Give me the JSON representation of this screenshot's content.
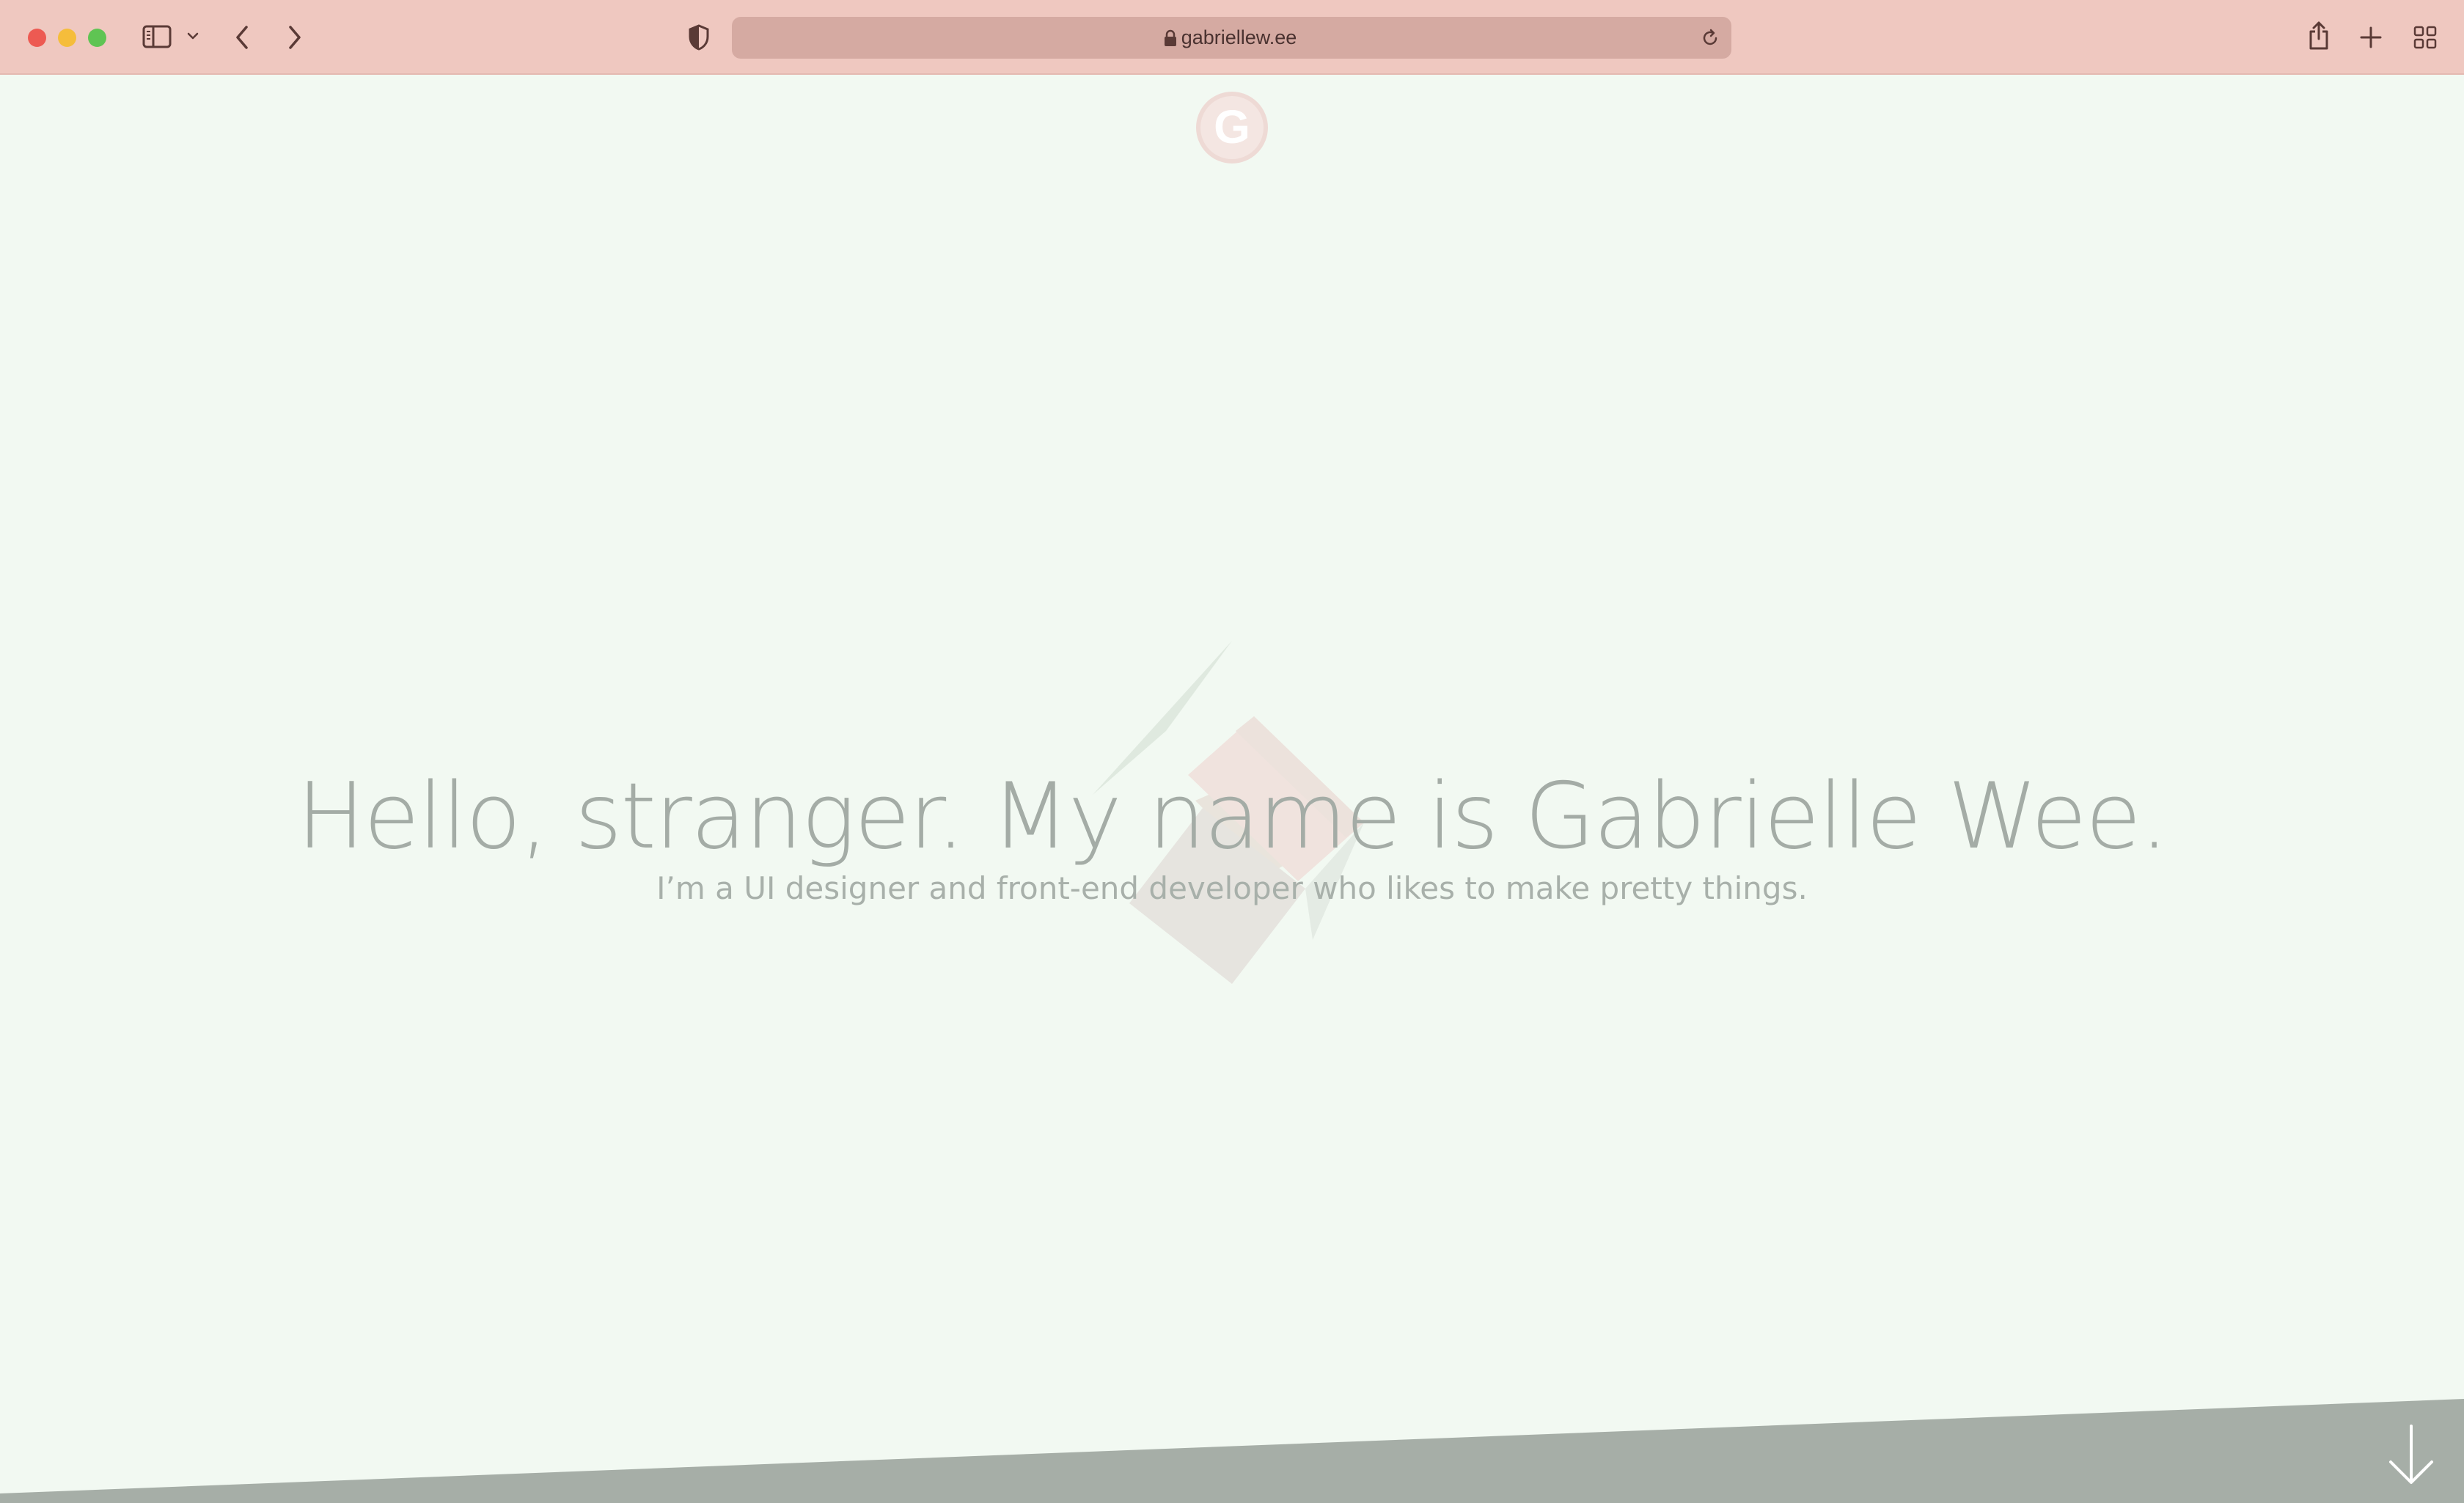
{
  "browser": {
    "url": "gabriellew.ee",
    "colors": {
      "toolbar": "#efc8c0",
      "address_bar": "#d5aaa2",
      "icon": "#5a3a36"
    }
  },
  "page": {
    "logo_letter": "G",
    "hero": {
      "title": "Hello, stranger. My name is Gabrielle Wee.",
      "subtitle": "I’m a UI designer and front-end developer who likes to make pretty things."
    },
    "colors": {
      "background": "#f2f9f2",
      "text": "#a4aca6",
      "footer_band": "#a6aea7"
    }
  }
}
